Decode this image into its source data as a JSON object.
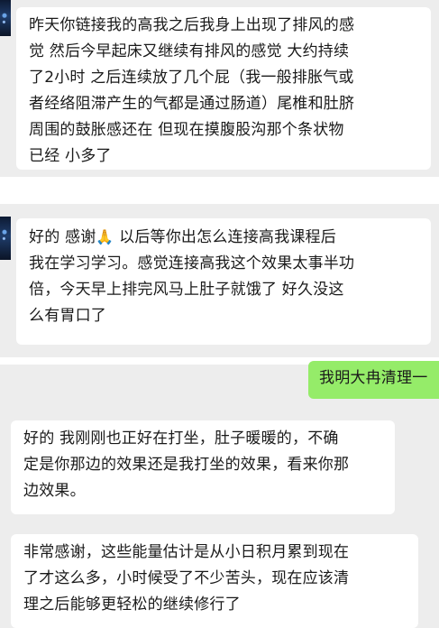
{
  "messages": [
    {
      "side": "left",
      "lines": [
        "昨天你链接我的高我之后我身上出现了排风的感",
        "觉 然后今早起床又继续有排风的感觉 大约持续",
        "了2小时 之后连续放了几个屁（我一般排胀气或",
        "者经络阻滞产生的气都是通过肠道）尾椎和肚脐",
        "周围的鼓胀感还在 但现在摸腹股沟那个条状物",
        "已经 小多了"
      ]
    },
    {
      "side": "left",
      "line1_before": "好的 感谢",
      "emoji": "🙏",
      "line1_after": " 以后等你出怎么连接高我课程后",
      "lines_rest": [
        "我在学习学习。感觉连接高我这个效果太事半功",
        "倍，今天早上排完风马上肚子就饿了 好久没这",
        "么有胃口了"
      ]
    },
    {
      "side": "right",
      "lines": [
        "我明大冉清理一"
      ]
    },
    {
      "side": "left",
      "lines": [
        "好的 我刚刚也正好在打坐，肚子暖暖的，不确",
        "定是你那边的效果还是我打坐的效果，看来你那",
        "边效果。"
      ]
    },
    {
      "side": "left",
      "lines": [
        "非常感谢，这些能量估计是从小日积月累到现在",
        "了才这么多，小时候受了不少苦头，现在应该清",
        "理之后能够更轻松的继续修行了"
      ]
    }
  ]
}
